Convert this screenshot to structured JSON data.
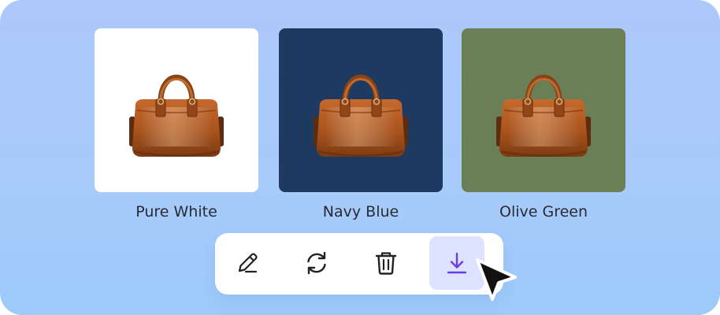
{
  "swatches": [
    {
      "label": "Pure White",
      "background": "#ffffff"
    },
    {
      "label": "Navy Blue",
      "background": "#1e3a60"
    },
    {
      "label": "Olive Green",
      "background": "#6b7f56"
    }
  ],
  "toolbar": {
    "buttons": [
      {
        "icon": "pencil-icon"
      },
      {
        "icon": "refresh-icon"
      },
      {
        "icon": "trash-icon"
      },
      {
        "icon": "download-icon",
        "active": true
      }
    ]
  },
  "colors": {
    "accent": "#6a3be6",
    "active_button_bg": "#dde3ff",
    "bag_leather": "#b05a22"
  }
}
